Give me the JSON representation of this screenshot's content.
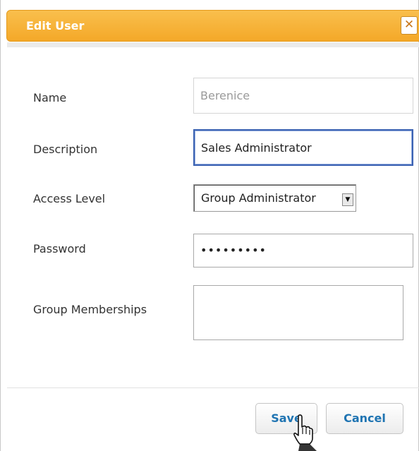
{
  "dialog": {
    "title": "Edit User",
    "close_icon": "close-icon",
    "accent_color": "#f5b03a"
  },
  "form": {
    "name": {
      "label": "Name",
      "value": "Berenice"
    },
    "description": {
      "label": "Description",
      "value": "Sales Administrator"
    },
    "access_level": {
      "label": "Access Level",
      "selected": "Group Administrator"
    },
    "password": {
      "label": "Password",
      "value": "•••••••••"
    },
    "group_memberships": {
      "label": "Group Memberships",
      "value": ""
    }
  },
  "buttons": {
    "save_label": "Save",
    "cancel_label": "Cancel"
  },
  "cursor": {
    "icon": "hand-pointer-icon"
  }
}
